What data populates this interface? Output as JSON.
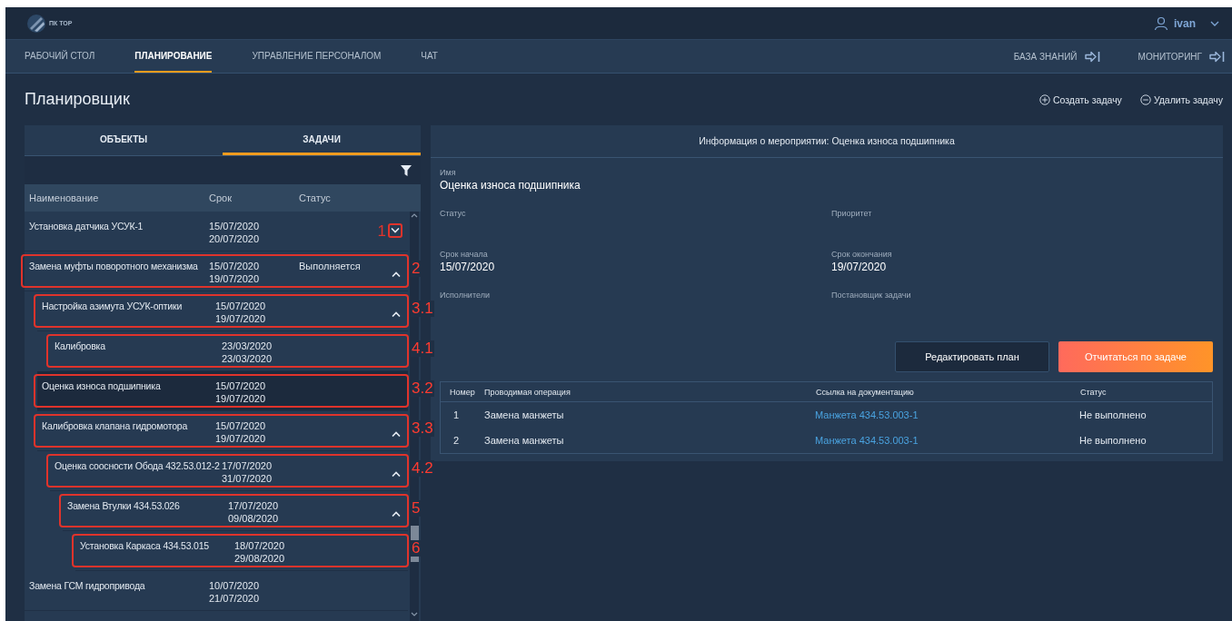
{
  "app": {
    "logo_text": "ПК ТОР",
    "user": "ivan"
  },
  "nav": {
    "tabs": [
      {
        "label": "РАБОЧИЙ СТОЛ",
        "selected": false
      },
      {
        "label": "ПЛАНИРОВАНИЕ",
        "selected": true
      },
      {
        "label": "УПРАВЛЕНИЕ ПЕРСОНАЛОМ",
        "selected": false
      },
      {
        "label": "ЧАТ",
        "selected": false
      }
    ],
    "links": [
      {
        "label": "БАЗА ЗНАНИЙ"
      },
      {
        "label": "МОНИТОРИНГ"
      }
    ]
  },
  "page": {
    "title": "Планировщик",
    "actions": [
      {
        "kind": "create",
        "label": "Создать задачу"
      },
      {
        "kind": "delete",
        "label": "Удалить задачу"
      }
    ]
  },
  "left_panel": {
    "tabs": [
      {
        "label": "ОБЪЕКТЫ",
        "selected": false
      },
      {
        "label": "ЗАДАЧИ",
        "selected": true
      }
    ],
    "columns": [
      "Наименование",
      "Срок",
      "Статус"
    ],
    "tasks": [
      {
        "name": "Установка датчика УСУК-1",
        "start": "15/07/2020",
        "end": "20/07/2020",
        "expanded": false,
        "selected": false,
        "annotation": {
          "label": "1",
          "kind": "toggle"
        }
      },
      {
        "name": "Замена муфты поворотного механизма",
        "start": "15/07/2020",
        "end": "19/07/2020",
        "status": "Выполняется",
        "expanded": true,
        "selected": false,
        "annotation": {
          "label": "2",
          "kind": "row"
        },
        "children": [
          {
            "name": "Настройка азимута УСУК-оптики",
            "start": "15/07/2020",
            "end": "19/07/2020",
            "expanded": true,
            "selected": false,
            "annotation": {
              "label": "3.1",
              "kind": "row"
            },
            "children": [
              {
                "name": "Калибровка",
                "start": "23/03/2020",
                "end": "23/03/2020",
                "selected": false,
                "annotation": {
                  "label": "4.1",
                  "kind": "row"
                }
              }
            ]
          },
          {
            "name": "Оценка износа подшипника",
            "start": "15/07/2020",
            "end": "19/07/2020",
            "selected": true,
            "annotation": {
              "label": "3.2",
              "kind": "row"
            }
          },
          {
            "name": "Калибровка клапана гидромотора",
            "start": "15/07/2020",
            "end": "19/07/2020",
            "expanded": true,
            "selected": false,
            "annotation": {
              "label": "3.3",
              "kind": "row"
            },
            "children": [
              {
                "name": "Оценка соосности Обода 432.53.012-2",
                "start": "17/07/2020",
                "end": "31/07/2020",
                "expanded": true,
                "selected": false,
                "annotation": {
                  "label": "4.2",
                  "kind": "row"
                },
                "children": [
                  {
                    "name": "Замена Втулки 434.53.026",
                    "start": "17/07/2020",
                    "end": "09/08/2020",
                    "expanded": true,
                    "selected": false,
                    "annotation": {
                      "label": "5",
                      "kind": "row"
                    },
                    "children": [
                      {
                        "name": "Установка Каркаса 434.53.015",
                        "start": "18/07/2020",
                        "end": "29/08/2020",
                        "selected": false,
                        "annotation": {
                          "label": "6",
                          "kind": "row"
                        }
                      }
                    ]
                  }
                ]
              }
            ]
          }
        ]
      },
      {
        "name": "Замена ГСМ гидропривода",
        "start": "10/07/2020",
        "end": "21/07/2020",
        "selected": false
      }
    ]
  },
  "details": {
    "title": "Информация о мероприятии: Оценка износа подшипника",
    "name_field": {
      "label": "Имя",
      "value": "Оценка износа подшипника"
    },
    "fields": [
      {
        "label": "Статус"
      },
      {
        "label": "Приоритет"
      },
      {
        "label": "Срок начала",
        "value": "15/07/2020"
      },
      {
        "label": "Срок окончания",
        "value": "19/07/2020"
      },
      {
        "label": "Исполнители"
      },
      {
        "label": "Постановщик задачи"
      }
    ],
    "buttons": [
      {
        "kind": "secondary",
        "label": "Редактировать план"
      },
      {
        "kind": "primary",
        "label": "Отчитаться по задаче"
      }
    ],
    "operations": {
      "columns": [
        "Номер",
        "Проводимая операция",
        "Ссылка на документацию",
        "Статус"
      ],
      "rows": [
        {
          "number": "1",
          "operation": "Замена манжеты",
          "document": "Манжета 434.53.003-1",
          "status": "Не выполнено"
        },
        {
          "number": "2",
          "operation": "Замена манжеты",
          "document": "Манжета 434.53.003-1",
          "status": "Не выполнено"
        }
      ]
    }
  }
}
